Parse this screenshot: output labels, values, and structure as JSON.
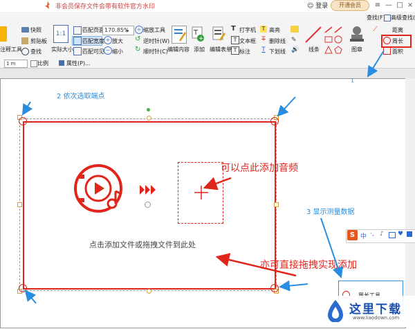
{
  "titlebar": {
    "title": "非会员保存文件会带有软件官方水印",
    "login": "登录",
    "vip_button": "开通会员"
  },
  "ribbon": {
    "annotate_tool": "注释工具",
    "snapshot": "快照",
    "clipboard": "剪贴板",
    "find": "查找",
    "actual_size": "实际大小",
    "fit_page": "匹配页面",
    "fit_width": "匹配宽度",
    "fit_visible": "匹配可见",
    "zoom_value": "170.85%",
    "zoom_tool": "缩放工具",
    "zoom_in": "放大",
    "zoom_out": "缩小",
    "rotate_left": "逆时针(W)",
    "rotate_right": "顺时针(C)",
    "edit_content": "编辑内容",
    "add": "添加",
    "edit_form": "编辑表单",
    "typewriter": "打字机",
    "textbox": "文本框",
    "callout": "标注",
    "highlight": "高亮",
    "strikethrough": "删除线",
    "underline": "下划线",
    "lines": "线条",
    "stamp": "图章",
    "distance": "距离",
    "perimeter": "周长",
    "area": "面积",
    "find_r": "查找(F)",
    "advanced_find": "高级查找(S)"
  },
  "subtoolbar": {
    "unit": "1 m",
    "scale": "比例",
    "properties": "属性(P)..."
  },
  "canvas": {
    "drop_hint": "点击添加文件或拖拽文件到此处",
    "ann_add_audio": "可以点此添加音频",
    "ann_drag_add": "亦可直接拖拽实现添加",
    "ann_step2": "2 依次选取端点",
    "ann_step3": "3 显示测量数据",
    "step1": "1",
    "perimeter_tool_label": "周长工具"
  },
  "ime": {
    "logo": "S",
    "mode": "中"
  },
  "watermark": {
    "text": "这里下载",
    "url": "www.liaodown.com"
  },
  "colors": {
    "accent_red": "#e0251b",
    "annotation_blue": "#2a8ee0",
    "ribbon_bg": "#f4f4f4"
  }
}
